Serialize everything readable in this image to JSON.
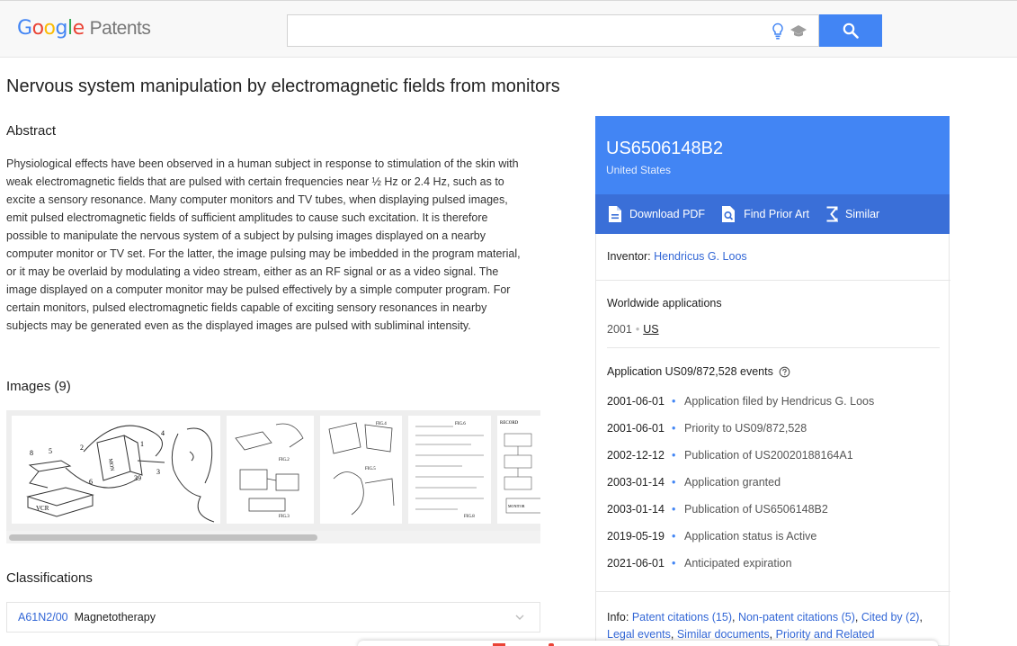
{
  "header": {
    "logo_letters": [
      "G",
      "o",
      "o",
      "g",
      "l",
      "e"
    ],
    "logo_product": "Patents",
    "search_value": "",
    "colors": {
      "blue": "#4285f4",
      "red": "#ea4335",
      "yellow": "#fbbc05",
      "green": "#34a853"
    }
  },
  "patent": {
    "title": "Nervous system manipulation by electromagnetic fields from monitors",
    "number": "US6506148B2",
    "country": "United States"
  },
  "abstract": {
    "heading": "Abstract",
    "text": "Physiological effects have been observed in a human subject in response to stimulation of the skin with weak electromagnetic fields that are pulsed with certain frequencies near ½ Hz or 2.4 Hz, such as to excite a sensory resonance. Many computer monitors and TV tubes, when displaying pulsed images, emit pulsed electromagnetic fields of sufficient amplitudes to cause such excitation. It is therefore possible to manipulate the nervous system of a subject by pulsing images displayed on a nearby computer monitor or TV set. For the latter, the image pulsing may be imbedded in the program material, or it may be overlaid by modulating a video stream, either as an RF signal or as a video signal. The image displayed on a computer monitor may be pulsed effectively by a simple computer program. For certain monitors, pulsed electromagnetic fields capable of exciting sensory resonances in nearby subjects may be generated even as the displayed images are pulsed with subliminal intensity."
  },
  "images": {
    "heading": "Images (9)",
    "thumb_labels": [
      "VCR",
      "MON",
      "8",
      "5",
      "2",
      "1",
      "4",
      "3",
      "39",
      "6",
      "FIG.2",
      "FIG.3",
      "FIG.4",
      "FIG.5",
      "FIG.6",
      "FIG.8",
      "RECORD",
      "MONITOR"
    ]
  },
  "classifications": {
    "heading": "Classifications",
    "code": "A61N2/00",
    "label": "Magnetotherapy"
  },
  "actions": {
    "download": "Download PDF",
    "prior_art": "Find Prior Art",
    "similar": "Similar"
  },
  "inventor": {
    "label": "Inventor:",
    "name": "Hendricus G. Loos"
  },
  "worldwide": {
    "title": "Worldwide applications",
    "year": "2001",
    "sep": "•",
    "country": "US"
  },
  "events": {
    "title": "Application US09/872,528 events",
    "items": [
      {
        "date": "2001-06-01",
        "desc": "Application filed by Hendricus G. Loos"
      },
      {
        "date": "2001-06-01",
        "desc": "Priority to US09/872,528"
      },
      {
        "date": "2002-12-12",
        "desc": "Publication of US20020188164A1"
      },
      {
        "date": "2003-01-14",
        "desc": "Application granted"
      },
      {
        "date": "2003-01-14",
        "desc": "Publication of US6506148B2"
      },
      {
        "date": "2019-05-19",
        "desc": "Application status is Active"
      },
      {
        "date": "2021-06-01",
        "desc": "Anticipated expiration"
      }
    ]
  },
  "info": {
    "label": "Info:",
    "links": [
      "Patent citations (15)",
      "Non-patent citations (5)",
      "Cited by (2)",
      "Legal events",
      "Similar documents",
      "Priority and Related"
    ]
  }
}
